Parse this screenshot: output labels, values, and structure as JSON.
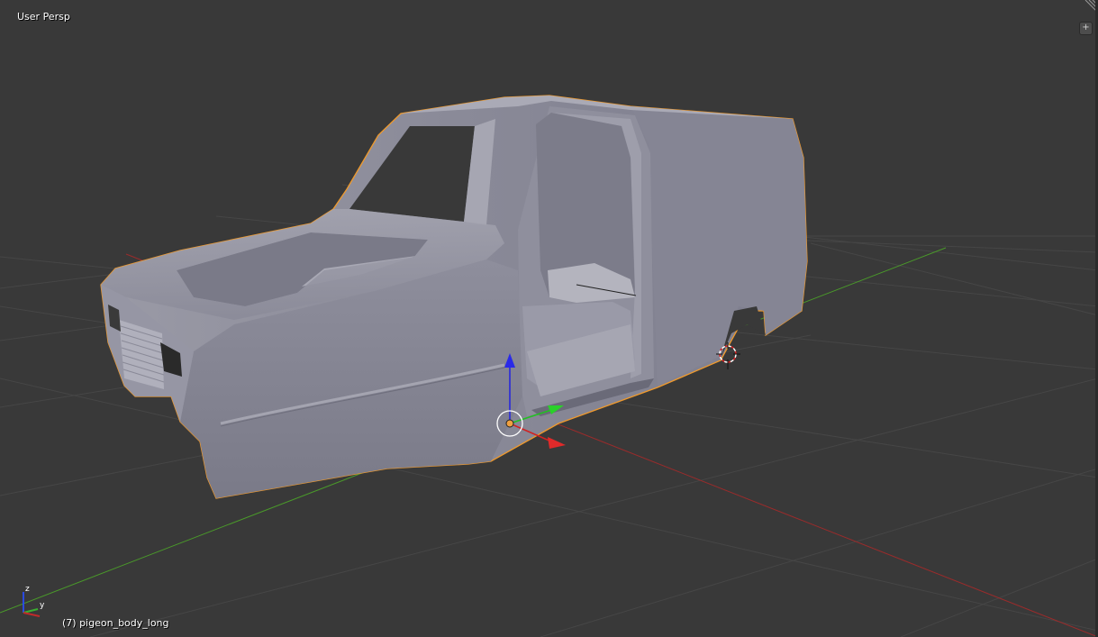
{
  "viewport": {
    "view_name": "User Persp",
    "object_info": "(7) pigeon_body_long",
    "add_region_glyph": "+"
  },
  "mini_axes": {
    "z": "z",
    "y": "y"
  },
  "colors": {
    "background": "#393939",
    "grid": "#444444",
    "x_axis": "#9a2a2a",
    "y_axis": "#4e9a2a",
    "body": "#8d8d9c",
    "selection_outline": "#f09a2c"
  },
  "icons": [
    "3d-cursor-icon",
    "object-origin-icon",
    "manipulator-icon",
    "axis-gizmo-icon",
    "add-region-icon"
  ]
}
